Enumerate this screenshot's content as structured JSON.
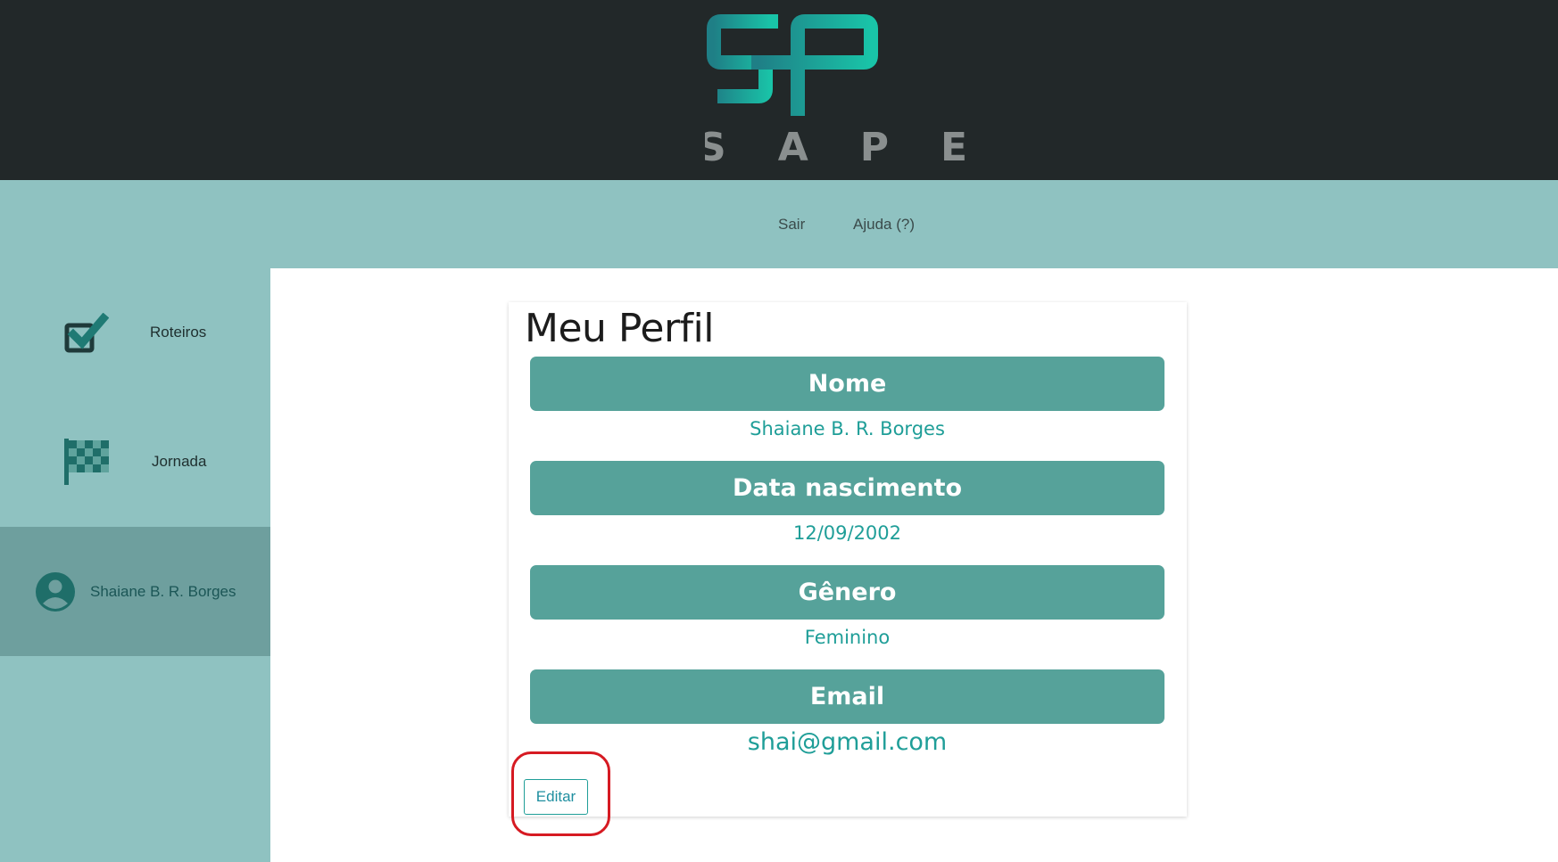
{
  "header": {
    "logo_text": "SAPE"
  },
  "topnav": {
    "items": [
      {
        "label": "Sair"
      },
      {
        "label": "Ajuda (?)"
      }
    ]
  },
  "sidebar": {
    "items": [
      {
        "label": "Roteiros",
        "icon": "checkbox-icon"
      },
      {
        "label": "Jornada",
        "icon": "checkered-flag-icon"
      },
      {
        "label": "Shaiane B. R. Borges",
        "icon": "user-avatar-icon",
        "active": true
      }
    ]
  },
  "profile": {
    "title": "Meu Perfil",
    "fields": [
      {
        "label": "Nome",
        "value": "Shaiane B. R. Borges"
      },
      {
        "label": "Data nascimento",
        "value": "12/09/2002"
      },
      {
        "label": "Gênero",
        "value": "Feminino"
      },
      {
        "label": "Email",
        "value": "shai@gmail.com"
      }
    ],
    "edit_label": "Editar"
  },
  "colors": {
    "header_bg": "#222829",
    "nav_bg": "#8fc2c1",
    "active_item_bg": "#6e9f9e",
    "field_header_bg": "#56a29a",
    "value_text": "#1f9e98",
    "highlight": "#d61a22"
  }
}
